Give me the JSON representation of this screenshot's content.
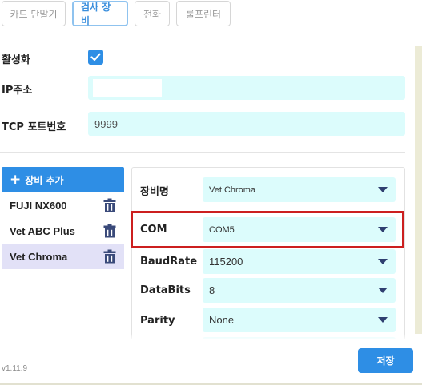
{
  "tabs": [
    {
      "label": "카드 단말기",
      "active": false
    },
    {
      "label": "검사 장비",
      "active": true
    },
    {
      "label": "전화",
      "active": false
    },
    {
      "label": "룰프린터",
      "active": false
    }
  ],
  "settings": {
    "activate_label": "활성화",
    "activate_checked": true,
    "ip_label": "IP주소",
    "ip_value": "",
    "port_label": "TCP 포트번호",
    "port_value": "9999"
  },
  "devices": {
    "add_label": "장비 추가",
    "items": [
      {
        "name": "FUJI NX600",
        "selected": false
      },
      {
        "name": "Vet ABC Plus",
        "selected": false
      },
      {
        "name": "Vet Chroma",
        "selected": true
      }
    ]
  },
  "detail": {
    "name_label": "장비명",
    "name_value": "Vet Chroma",
    "com_label": "COM",
    "com_value": "COM5",
    "baud_label": "BaudRate",
    "baud_value": "115200",
    "databits_label": "DataBits",
    "databits_value": "8",
    "parity_label": "Parity",
    "parity_value": "None"
  },
  "footer": {
    "version": "v1.11.9",
    "save_label": "저장"
  },
  "colors": {
    "accent": "#2e8ee5",
    "field_bg": "#dcfcfc",
    "highlight": "#cc1f1f",
    "selected_bg": "#e2e1f7"
  }
}
